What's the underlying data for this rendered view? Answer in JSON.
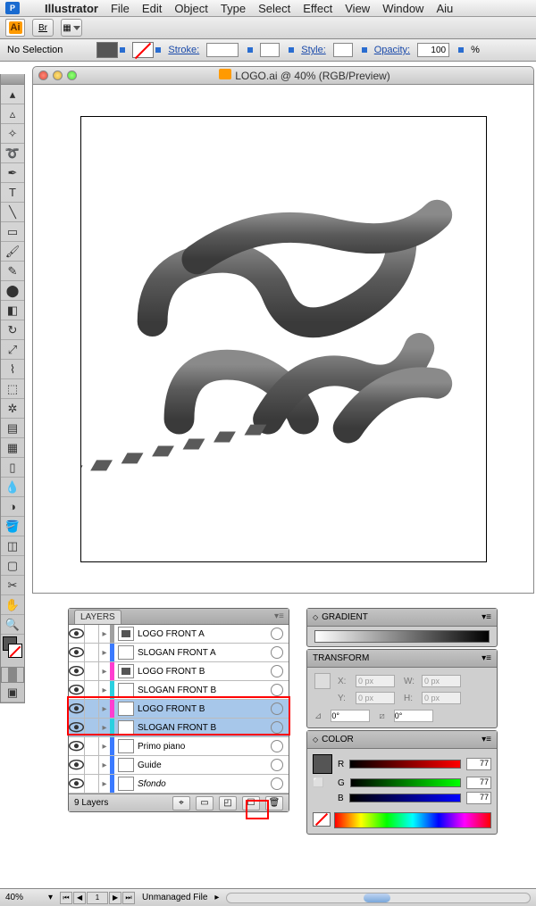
{
  "menubar": {
    "app": "Illustrator",
    "items": [
      "File",
      "Edit",
      "Object",
      "Type",
      "Select",
      "Effect",
      "View",
      "Window",
      "Aiu"
    ]
  },
  "appbar": {
    "ai": "Ai",
    "br": "Br"
  },
  "ctrlbar": {
    "selection": "No Selection",
    "stroke_label": "Stroke:",
    "stroke_val": "",
    "style_label": "Style:",
    "opacity_label": "Opacity:",
    "opacity_val": "100",
    "opacity_unit": "%"
  },
  "doc": {
    "title": "LOGO.ai @ 40% (RGB/Preview)"
  },
  "layers": {
    "title": "LAYERS",
    "rows": [
      {
        "name": "LOGO FRONT A",
        "color": "#a0a0a0",
        "sel": false,
        "italic": false,
        "thumbDark": true
      },
      {
        "name": "SLOGAN FRONT A",
        "color": "#3a7aff",
        "sel": false,
        "italic": false,
        "thumbDark": false
      },
      {
        "name": "LOGO FRONT B",
        "color": "#ff3dd0",
        "sel": false,
        "italic": false,
        "thumbDark": true
      },
      {
        "name": "SLOGAN FRONT B",
        "color": "#2bd0e0",
        "sel": false,
        "italic": false,
        "thumbDark": false
      },
      {
        "name": "LOGO FRONT B",
        "color": "#ff3dd0",
        "sel": true,
        "italic": false,
        "thumbDark": false
      },
      {
        "name": "SLOGAN FRONT B",
        "color": "#2bd0e0",
        "sel": true,
        "italic": false,
        "thumbDark": false
      },
      {
        "name": "Primo piano",
        "color": "#3a7aff",
        "sel": false,
        "italic": false,
        "thumbDark": false
      },
      {
        "name": "Guide",
        "color": "#3a7aff",
        "sel": false,
        "italic": false,
        "thumbDark": false
      },
      {
        "name": "Sfondo",
        "color": "#3a7aff",
        "sel": false,
        "italic": true,
        "thumbDark": false
      }
    ],
    "count_label": "9 Layers"
  },
  "gradient": {
    "title": "GRADIENT"
  },
  "transform": {
    "title": "TRANSFORM",
    "x_label": "X:",
    "x_val": "0 px",
    "y_label": "Y:",
    "y_val": "0 px",
    "w_label": "W:",
    "w_val": "0 px",
    "h_label": "H:",
    "h_val": "0 px",
    "angle": "0°",
    "shear": "0°"
  },
  "color": {
    "title": "COLOR",
    "r": "77",
    "g": "77",
    "b": "77"
  },
  "status": {
    "zoom": "40%",
    "page": "1",
    "file_status": "Unmanaged File"
  },
  "icons": {
    "apple": "",
    "eye": "👁",
    "trash": "🗑",
    "new": "☐",
    "locate": "⌖",
    "clip": "▭"
  }
}
